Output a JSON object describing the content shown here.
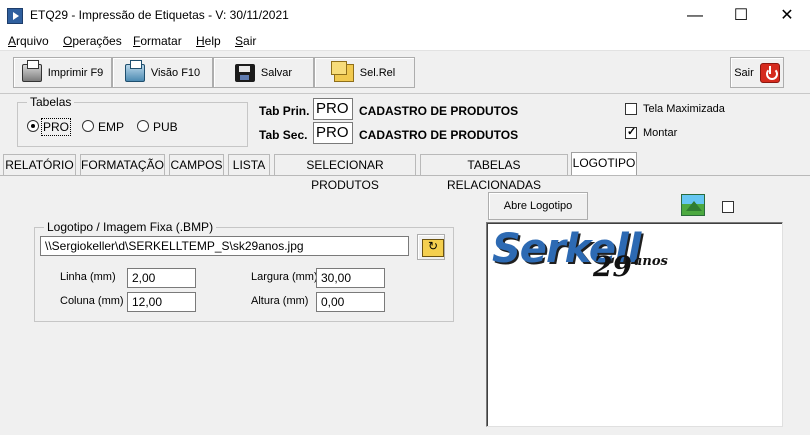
{
  "window": {
    "title": "ETQ29 - Impressão de Etiquetas - V: 30/11/2021",
    "minimize": "—",
    "maximize": "☐",
    "close": "✕"
  },
  "menu": {
    "items": [
      {
        "first": "A",
        "rest": "rquivo"
      },
      {
        "first": "O",
        "rest": "perações"
      },
      {
        "first": "F",
        "rest": "ormatar"
      },
      {
        "first": "H",
        "rest": "elp"
      },
      {
        "first": "S",
        "rest": "air"
      }
    ]
  },
  "toolbar": {
    "imprimir": "Imprimir F9",
    "visao": "Visão F10",
    "salvar": "Salvar",
    "selrel": "Sel.Rel",
    "sair": "Sair"
  },
  "tabelas": {
    "legend": "Tabelas",
    "options": [
      "PRO",
      "EMP",
      "PUB"
    ],
    "selected": "PRO"
  },
  "tab_prin": {
    "label": "Tab Prin.",
    "code": "PRO",
    "desc": "CADASTRO DE PRODUTOS"
  },
  "tab_sec": {
    "label": "Tab Sec.",
    "code": "PRO",
    "desc": "CADASTRO DE PRODUTOS"
  },
  "options": {
    "tela_maximizada": {
      "label": "Tela Maximizada",
      "checked": false
    },
    "montar": {
      "label": "Montar",
      "checked": true
    }
  },
  "tabs": [
    "RELATÓRIO",
    "FORMATAÇÃO",
    "CAMPOS",
    "LISTA",
    "SELECIONAR PRODUTOS",
    "TABELAS RELACIONADAS",
    "LOGOTIPO"
  ],
  "active_tab": "LOGOTIPO",
  "logotipo": {
    "legend": "Logotipo / Imagem Fixa (.BMP)",
    "path": "\\\\Sergiokeller\\d\\SERKELLTEMP_S\\sk29anos.jpg",
    "linha_label": "Linha (mm)",
    "linha": "2,00",
    "coluna_label": "Coluna (mm)",
    "coluna": "12,00",
    "largura_label": "Largura (mm)",
    "largura": "30,00",
    "altura_label": "Altura (mm)",
    "altura": "0,00",
    "abre_button": "Abre  Logotipo"
  },
  "logo_image": {
    "brand": "Serkell",
    "number": "29",
    "suffix": "anos"
  }
}
